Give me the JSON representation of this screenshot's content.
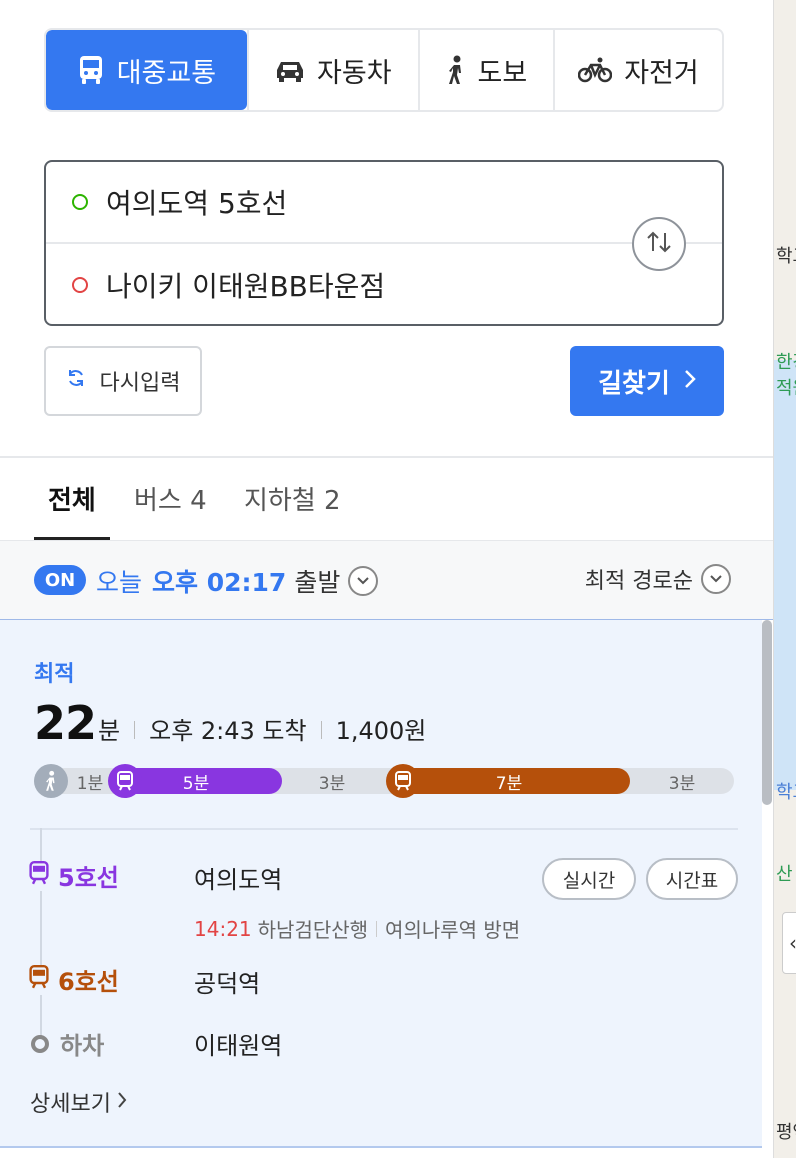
{
  "modes": [
    {
      "label": "대중교통",
      "icon": "bus-icon",
      "active": true
    },
    {
      "label": "자동차",
      "icon": "car-icon",
      "active": false
    },
    {
      "label": "도보",
      "icon": "walk-icon",
      "active": false
    },
    {
      "label": "자전거",
      "icon": "bicycle-icon",
      "active": false
    }
  ],
  "route": {
    "origin": "여의도역 5호선",
    "destination": "나이키 이태원BB타운점",
    "swap_icon": "swap-arrows-icon"
  },
  "actions": {
    "reset_label": "다시입력",
    "search_label": "길찾기"
  },
  "filter_tabs": [
    {
      "label": "전체",
      "active": true
    },
    {
      "label": "버스 4",
      "active": false
    },
    {
      "label": "지하철 2",
      "active": false
    }
  ],
  "options": {
    "on_badge": "ON",
    "today": "오늘",
    "depart_time": "오후 02:17",
    "depart_suffix": "출발",
    "sort_label": "최적 경로순"
  },
  "result": {
    "badge": "최적",
    "minutes": "22",
    "minutes_unit": "분",
    "arrival": "오후 2:43 도착",
    "fare": "1,400원",
    "timeline": {
      "walk1": "1분",
      "line5_duration": "5분",
      "walk2": "3분",
      "line6_duration": "7분",
      "walk3": "3분"
    },
    "steps": [
      {
        "line": "5호선",
        "station": "여의도역",
        "color": "#8936e0"
      },
      {
        "line": "6호선",
        "station": "공덕역",
        "color": "#b5500b"
      },
      {
        "line": "하차",
        "station": "이태원역",
        "color": "#888888"
      }
    ],
    "realtime_label": "실시간",
    "timetable_label": "시간표",
    "direction": {
      "time": "14:21",
      "headsign": "하남검단산행",
      "next": "여의나루역 방면"
    },
    "detail_label": "상세보기"
  },
  "map": {
    "labels": [
      "학고",
      "한강",
      "적원",
      "학교",
      "산",
      "평역"
    ]
  },
  "colors": {
    "accent": "#3478f0",
    "line5": "#8936e0",
    "line6": "#b5500b"
  }
}
